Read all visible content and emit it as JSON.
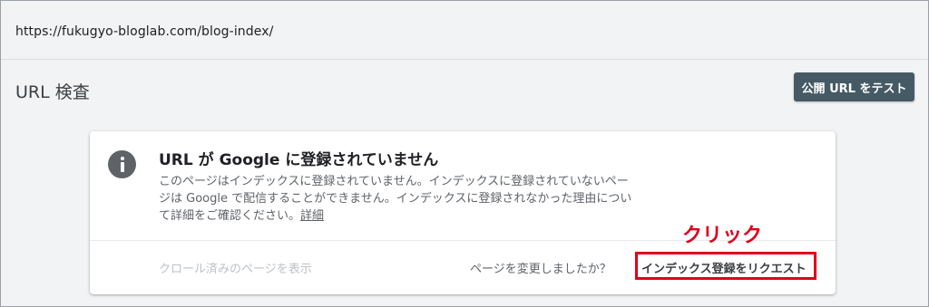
{
  "url_bar": {
    "url": "https://fukugyo-bloglab.com/blog-index/"
  },
  "header": {
    "title": "URL 検査",
    "test_live_label": "公開 URL をテスト"
  },
  "status_card": {
    "icon": "info-icon",
    "title": "URL が Google に登録されていません",
    "description": "このページはインデックスに登録されていません。インデックスに登録されていないページは Google で配信することができません。インデックスに登録されなかった理由について詳細をご確認ください。",
    "learn_more": "詳細",
    "view_crawled_label": "クロール済みのページを表示",
    "changed_question": "ページを変更しましたか？",
    "request_indexing_label": "インデックス登録をリクエスト"
  },
  "annotation": {
    "text": "クリック",
    "color": "#e0001b"
  },
  "colors": {
    "button_bg": "#455a64",
    "background": "#f1f3f4",
    "info_icon": "#5f6368"
  }
}
